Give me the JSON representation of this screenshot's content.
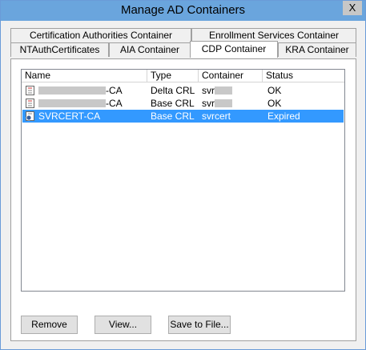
{
  "window": {
    "title": "Manage AD Containers",
    "close_label": "X"
  },
  "tabs_back": [
    "Certification Authorities Container",
    "Enrollment Services Container"
  ],
  "tabs_front": [
    "NTAuthCertificates",
    "AIA Container",
    "CDP Container",
    "KRA Container"
  ],
  "active_tab": "CDP Container",
  "columns": [
    "Name",
    "Type",
    "Container",
    "Status"
  ],
  "rows": [
    {
      "name": "-CA",
      "type": "Delta CRL",
      "container": "svr",
      "status": "OK",
      "selected": false
    },
    {
      "name": "-CA",
      "type": "Base CRL",
      "container": "svr",
      "status": "OK",
      "selected": false
    },
    {
      "name": "SVRCERT-CA",
      "type": "Base CRL",
      "container": "svrcert",
      "status": "Expired",
      "selected": true
    }
  ],
  "buttons": {
    "remove": "Remove",
    "view": "View...",
    "save": "Save to File..."
  },
  "colors": {
    "titlebar": "#6aa5dd",
    "selection": "#3399ff"
  }
}
